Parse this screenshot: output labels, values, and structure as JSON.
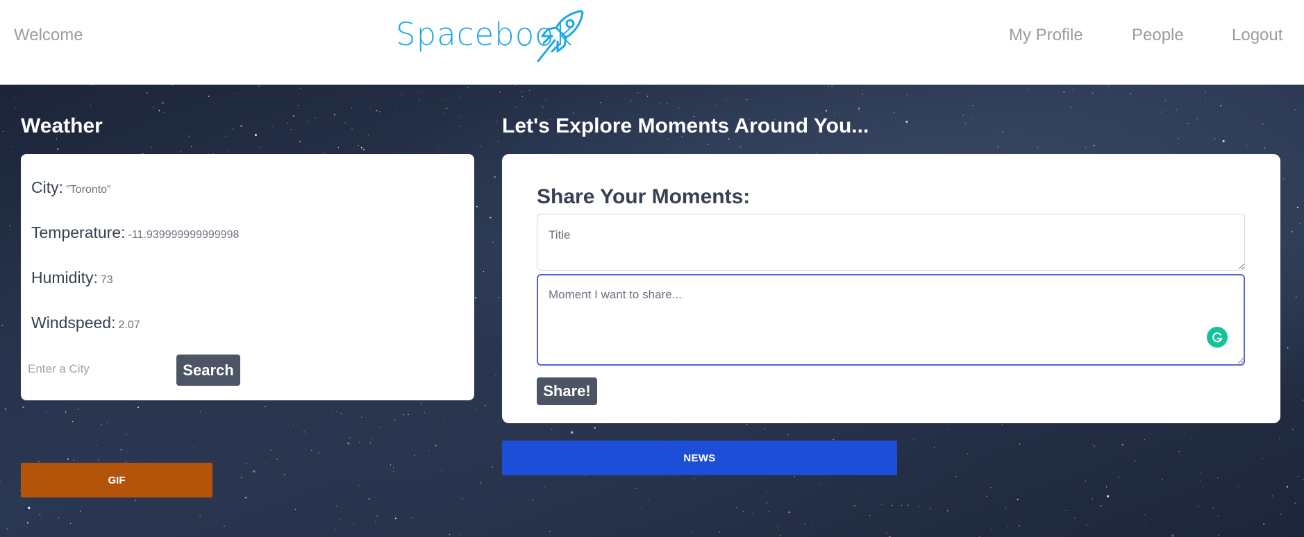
{
  "header": {
    "welcome": "Welcome",
    "logo_text": "Spacebook",
    "nav": {
      "profile": "My Profile",
      "people": "People",
      "logout": "Logout"
    }
  },
  "weather": {
    "title": "Weather",
    "city_label": "City:",
    "city_value": "\"Toronto\"",
    "temperature_label": "Temperature:",
    "temperature_value": "-11.939999999999998",
    "humidity_label": "Humidity:",
    "humidity_value": "73",
    "windspeed_label": "Windspeed:",
    "windspeed_value": "2.07",
    "input_placeholder": "Enter a City",
    "search_label": "Search"
  },
  "moments": {
    "title": "Let's Explore Moments Around You...",
    "share_heading": "Share Your Moments:",
    "title_placeholder": "Title",
    "moment_placeholder": "Moment I want to share...",
    "share_label": "Share!"
  },
  "buttons": {
    "news": "NEWS",
    "gif": "GIF"
  },
  "colors": {
    "logo_blue": "#19a6e8",
    "news_blue": "#1d4ed8",
    "gif_orange": "#b4530a",
    "button_gray": "#4b5563",
    "grammarly_green": "#15c39a"
  }
}
